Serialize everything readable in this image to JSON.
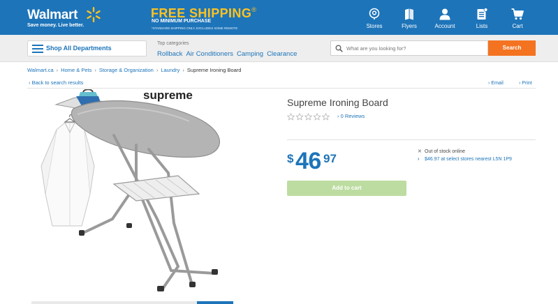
{
  "header": {
    "logo_text": "Walmart",
    "tagline": "Save money. Live better.",
    "shipping_title": "FREE SHIPPING",
    "shipping_trademark": "®",
    "shipping_subtitle": "NO MINIMUM PURCHASE",
    "shipping_note": "*STANDARD SHIPPING ONLY, EXCLUDES SOME REMOTE",
    "brand_color": "#1d74b9",
    "accent_color": "#ffc220",
    "nav": [
      {
        "label": "Stores",
        "icon": "store-pin-icon"
      },
      {
        "label": "Flyers",
        "icon": "flyer-icon"
      },
      {
        "label": "Account",
        "icon": "account-icon"
      },
      {
        "label": "Lists",
        "icon": "list-icon"
      },
      {
        "label": "Cart",
        "icon": "cart-icon"
      }
    ]
  },
  "catbar": {
    "shop_all": "Shop All Departments",
    "top_categories_caption": "Top categories",
    "top_categories": [
      "Rollback",
      "Air Conditioners",
      "Camping",
      "Clearance"
    ],
    "search_placeholder": "What are you looking for?",
    "search_button": "Search",
    "search_button_color": "#f47321"
  },
  "breadcrumb": {
    "items": [
      "Walmart.ca",
      "Home & Pets",
      "Storage & Organization",
      "Laundry"
    ],
    "current": "Supreme Ironing Board",
    "separator": "›"
  },
  "utility": {
    "back": "Back to search results",
    "email": "Email",
    "print": "Print",
    "chevron_left": "‹",
    "chevron_right": "›"
  },
  "product": {
    "image_text": "supreme",
    "title": "Supreme Ironing Board",
    "reviews": "0 Reviews",
    "rating": 0,
    "rating_max": 5,
    "price_currency": "$",
    "price_dollars": "46",
    "price_cents": "97",
    "availability_online": "Out of stock online",
    "availability_store": "$46.97 at select stores nearest L5N 1P9",
    "add_to_cart": "Add to cart",
    "add_to_cart_color": "#bddca1"
  }
}
